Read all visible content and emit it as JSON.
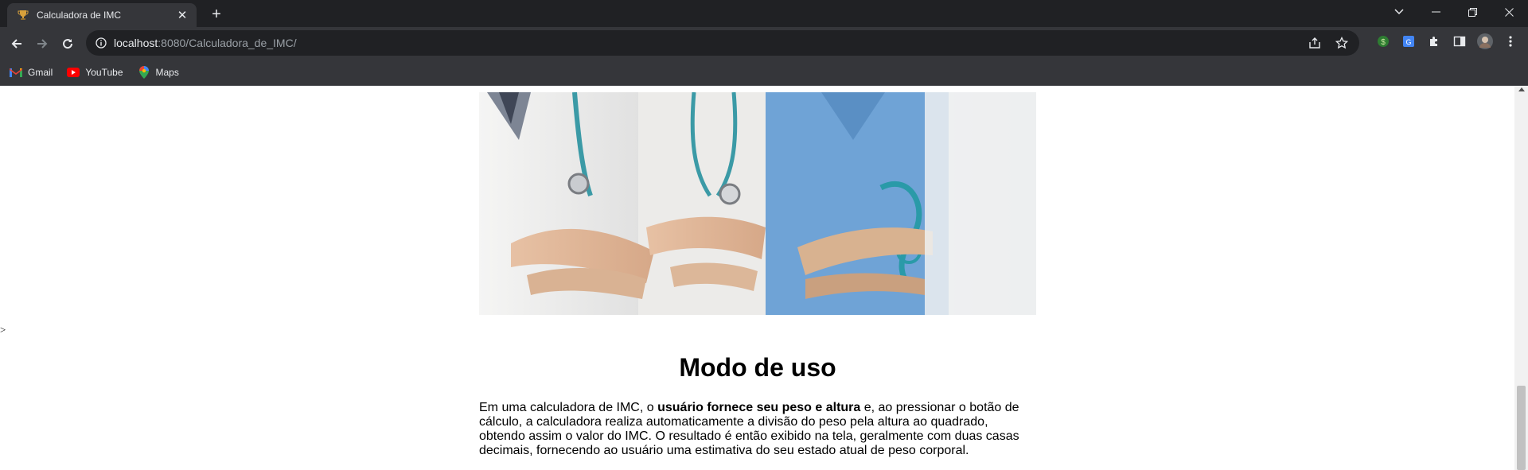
{
  "browser": {
    "tab_title": "Calculadora de IMC",
    "url_host": "localhost",
    "url_rest": ":8080/Calculadora_de_IMC/",
    "bookmarks": [
      {
        "label": "Gmail",
        "icon": "gmail-icon"
      },
      {
        "label": "YouTube",
        "icon": "youtube-icon"
      },
      {
        "label": "Maps",
        "icon": "maps-icon"
      }
    ]
  },
  "page": {
    "stray_text": ">",
    "hero_alt": "Doctors with stethoscopes, arms crossed",
    "section_title": "Modo de uso",
    "paragraph": {
      "part1": "Em uma calculadora de IMC, o ",
      "bold": "usuário fornece seu peso e altura",
      "part2": " e, ao pressionar o botão de cálculo, a calculadora realiza automaticamente a divisão do peso pela altura ao quadrado, obtendo assim o valor do IMC. O resultado é então exibido na tela, geralmente com duas casas decimais, fornecendo ao usuário uma estimativa do seu estado atual de peso corporal."
    }
  },
  "colors": {
    "titlebar": "#202124",
    "toolbar": "#35363a",
    "text_light": "#e8eaed",
    "scrubs_blue": "#6fa3d6",
    "stethoscope_teal": "#2a9aa8"
  }
}
